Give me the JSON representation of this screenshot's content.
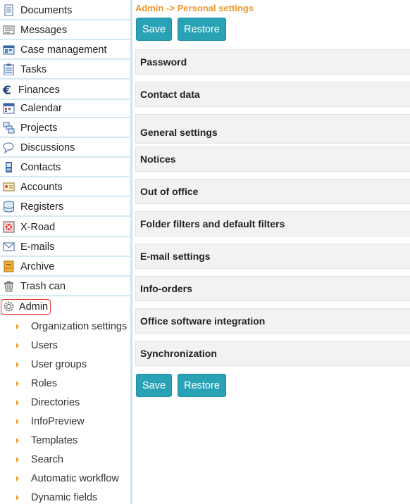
{
  "sidebar": {
    "items": [
      {
        "label": "Documents",
        "icon": "document-icon"
      },
      {
        "label": "Messages",
        "icon": "message-icon"
      },
      {
        "label": "Case management",
        "icon": "case-icon"
      },
      {
        "label": "Tasks",
        "icon": "task-clipboard-icon"
      },
      {
        "label": "Finances",
        "icon": "euro-icon"
      },
      {
        "label": "Calendar",
        "icon": "calendar-icon"
      },
      {
        "label": "Projects",
        "icon": "project-icon"
      },
      {
        "label": "Discussions",
        "icon": "discussion-icon"
      },
      {
        "label": "Contacts",
        "icon": "contact-phone-icon"
      },
      {
        "label": "Accounts",
        "icon": "account-icon"
      },
      {
        "label": "Registers",
        "icon": "database-icon"
      },
      {
        "label": "X-Road",
        "icon": "xroad-icon"
      },
      {
        "label": "E-mails",
        "icon": "envelope-icon"
      },
      {
        "label": "Archive",
        "icon": "archive-icon"
      },
      {
        "label": "Trash can",
        "icon": "trash-icon"
      },
      {
        "label": "Admin",
        "icon": "gear-icon"
      }
    ],
    "admin_subitems": [
      "Organization settings",
      "Users",
      "User groups",
      "Roles",
      "Directories",
      "InfoPreview",
      "Templates",
      "Search",
      "Automatic workflow",
      "Dynamic fields"
    ]
  },
  "main": {
    "breadcrumb": "Admin -> Personal settings",
    "save_label": "Save",
    "restore_label": "Restore",
    "sections": [
      "Password",
      "Contact data",
      "General settings",
      "Notices",
      "Out of office",
      "Folder filters and default filters",
      "E-mail settings",
      "Info-orders",
      "Office software integration",
      "Synchronization"
    ]
  },
  "colors": {
    "accent_button": "#2aa2b6",
    "breadcrumb": "#f0932b",
    "admin_highlight": "#e53935"
  }
}
